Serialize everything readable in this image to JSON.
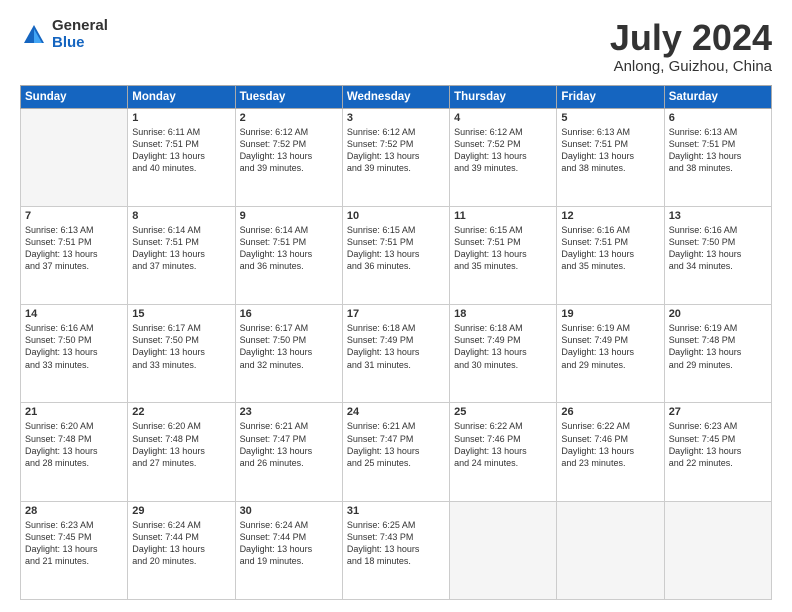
{
  "header": {
    "logo_general": "General",
    "logo_blue": "Blue",
    "month_title": "July 2024",
    "location": "Anlong, Guizhou, China"
  },
  "days_of_week": [
    "Sunday",
    "Monday",
    "Tuesday",
    "Wednesday",
    "Thursday",
    "Friday",
    "Saturday"
  ],
  "weeks": [
    [
      {
        "day": "",
        "info": ""
      },
      {
        "day": "1",
        "info": "Sunrise: 6:11 AM\nSunset: 7:51 PM\nDaylight: 13 hours\nand 40 minutes."
      },
      {
        "day": "2",
        "info": "Sunrise: 6:12 AM\nSunset: 7:52 PM\nDaylight: 13 hours\nand 39 minutes."
      },
      {
        "day": "3",
        "info": "Sunrise: 6:12 AM\nSunset: 7:52 PM\nDaylight: 13 hours\nand 39 minutes."
      },
      {
        "day": "4",
        "info": "Sunrise: 6:12 AM\nSunset: 7:52 PM\nDaylight: 13 hours\nand 39 minutes."
      },
      {
        "day": "5",
        "info": "Sunrise: 6:13 AM\nSunset: 7:51 PM\nDaylight: 13 hours\nand 38 minutes."
      },
      {
        "day": "6",
        "info": "Sunrise: 6:13 AM\nSunset: 7:51 PM\nDaylight: 13 hours\nand 38 minutes."
      }
    ],
    [
      {
        "day": "7",
        "info": "Sunrise: 6:13 AM\nSunset: 7:51 PM\nDaylight: 13 hours\nand 37 minutes."
      },
      {
        "day": "8",
        "info": "Sunrise: 6:14 AM\nSunset: 7:51 PM\nDaylight: 13 hours\nand 37 minutes."
      },
      {
        "day": "9",
        "info": "Sunrise: 6:14 AM\nSunset: 7:51 PM\nDaylight: 13 hours\nand 36 minutes."
      },
      {
        "day": "10",
        "info": "Sunrise: 6:15 AM\nSunset: 7:51 PM\nDaylight: 13 hours\nand 36 minutes."
      },
      {
        "day": "11",
        "info": "Sunrise: 6:15 AM\nSunset: 7:51 PM\nDaylight: 13 hours\nand 35 minutes."
      },
      {
        "day": "12",
        "info": "Sunrise: 6:16 AM\nSunset: 7:51 PM\nDaylight: 13 hours\nand 35 minutes."
      },
      {
        "day": "13",
        "info": "Sunrise: 6:16 AM\nSunset: 7:50 PM\nDaylight: 13 hours\nand 34 minutes."
      }
    ],
    [
      {
        "day": "14",
        "info": "Sunrise: 6:16 AM\nSunset: 7:50 PM\nDaylight: 13 hours\nand 33 minutes."
      },
      {
        "day": "15",
        "info": "Sunrise: 6:17 AM\nSunset: 7:50 PM\nDaylight: 13 hours\nand 33 minutes."
      },
      {
        "day": "16",
        "info": "Sunrise: 6:17 AM\nSunset: 7:50 PM\nDaylight: 13 hours\nand 32 minutes."
      },
      {
        "day": "17",
        "info": "Sunrise: 6:18 AM\nSunset: 7:49 PM\nDaylight: 13 hours\nand 31 minutes."
      },
      {
        "day": "18",
        "info": "Sunrise: 6:18 AM\nSunset: 7:49 PM\nDaylight: 13 hours\nand 30 minutes."
      },
      {
        "day": "19",
        "info": "Sunrise: 6:19 AM\nSunset: 7:49 PM\nDaylight: 13 hours\nand 29 minutes."
      },
      {
        "day": "20",
        "info": "Sunrise: 6:19 AM\nSunset: 7:48 PM\nDaylight: 13 hours\nand 29 minutes."
      }
    ],
    [
      {
        "day": "21",
        "info": "Sunrise: 6:20 AM\nSunset: 7:48 PM\nDaylight: 13 hours\nand 28 minutes."
      },
      {
        "day": "22",
        "info": "Sunrise: 6:20 AM\nSunset: 7:48 PM\nDaylight: 13 hours\nand 27 minutes."
      },
      {
        "day": "23",
        "info": "Sunrise: 6:21 AM\nSunset: 7:47 PM\nDaylight: 13 hours\nand 26 minutes."
      },
      {
        "day": "24",
        "info": "Sunrise: 6:21 AM\nSunset: 7:47 PM\nDaylight: 13 hours\nand 25 minutes."
      },
      {
        "day": "25",
        "info": "Sunrise: 6:22 AM\nSunset: 7:46 PM\nDaylight: 13 hours\nand 24 minutes."
      },
      {
        "day": "26",
        "info": "Sunrise: 6:22 AM\nSunset: 7:46 PM\nDaylight: 13 hours\nand 23 minutes."
      },
      {
        "day": "27",
        "info": "Sunrise: 6:23 AM\nSunset: 7:45 PM\nDaylight: 13 hours\nand 22 minutes."
      }
    ],
    [
      {
        "day": "28",
        "info": "Sunrise: 6:23 AM\nSunset: 7:45 PM\nDaylight: 13 hours\nand 21 minutes."
      },
      {
        "day": "29",
        "info": "Sunrise: 6:24 AM\nSunset: 7:44 PM\nDaylight: 13 hours\nand 20 minutes."
      },
      {
        "day": "30",
        "info": "Sunrise: 6:24 AM\nSunset: 7:44 PM\nDaylight: 13 hours\nand 19 minutes."
      },
      {
        "day": "31",
        "info": "Sunrise: 6:25 AM\nSunset: 7:43 PM\nDaylight: 13 hours\nand 18 minutes."
      },
      {
        "day": "",
        "info": ""
      },
      {
        "day": "",
        "info": ""
      },
      {
        "day": "",
        "info": ""
      }
    ]
  ]
}
